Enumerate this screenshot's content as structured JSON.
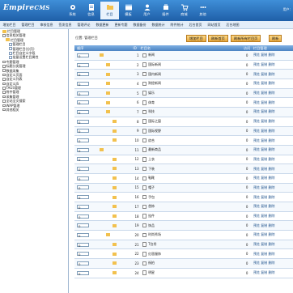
{
  "app": {
    "logo_main": "Empire",
    "logo_sub": "CMS",
    "user_text": "用户:"
  },
  "nav": {
    "items": [
      {
        "label": "系统",
        "icon": "gear-icon"
      },
      {
        "label": "信息",
        "icon": "doc-icon"
      },
      {
        "label": "栏目",
        "icon": "folder-icon",
        "active": true
      },
      {
        "label": "模板",
        "icon": "template-icon"
      },
      {
        "label": "用户",
        "icon": "user-icon"
      },
      {
        "label": "插件",
        "icon": "plugin-icon"
      },
      {
        "label": "商城",
        "icon": "cart-icon"
      },
      {
        "label": "其他",
        "icon": "other-icon"
      }
    ]
  },
  "subnav": {
    "items": [
      "增加栏目",
      "管理栏目",
      "审核信息",
      "签发信息",
      "管理评论",
      "数据更新",
      "更新专题",
      "数据备份",
      "数据统计",
      "附件统计",
      "后台首页",
      "网站首页",
      "后台地图"
    ]
  },
  "sidebar": {
    "items": [
      {
        "label": "栏目管理",
        "level": 0,
        "icon": "folder"
      },
      {
        "label": "信息相关管理",
        "level": 0,
        "icon": "plus"
      },
      {
        "label": "栏目管理",
        "level": 1,
        "icon": "folder"
      },
      {
        "label": "管理栏目",
        "level": 2,
        "icon": "doc"
      },
      {
        "label": "管理栏目(分页)",
        "level": 2,
        "icon": "doc"
      },
      {
        "label": "栏目自定义字段",
        "level": 2,
        "icon": "doc"
      },
      {
        "label": "批量设置栏目属性",
        "level": 2,
        "icon": "doc"
      },
      {
        "label": "专题管理",
        "level": 0,
        "icon": "plus"
      },
      {
        "label": "标题分类管理",
        "level": 0,
        "icon": "plus"
      },
      {
        "label": "数据采集",
        "level": 0,
        "icon": "plus"
      },
      {
        "label": "自定义页面",
        "level": 0,
        "icon": "plus"
      },
      {
        "label": "自定义列表",
        "level": 0,
        "icon": "plus"
      },
      {
        "label": "自定义JS",
        "level": 0,
        "icon": "plus"
      },
      {
        "label": "TAGS管理",
        "level": 0,
        "icon": "plus"
      },
      {
        "label": "附件管理",
        "level": 0,
        "icon": "plus"
      },
      {
        "label": "采集管理",
        "level": 0,
        "icon": "plus"
      },
      {
        "label": "全站全文搜索",
        "level": 0,
        "icon": "plus"
      },
      {
        "label": "WAP管理",
        "level": 0,
        "icon": "plus"
      },
      {
        "label": "其他相关",
        "level": 0,
        "icon": "plus"
      }
    ]
  },
  "main": {
    "breadcrumb": "位置: 管理栏目",
    "buttons": [
      "增加栏目",
      "刷新首页",
      "刷新所有栏目页",
      "刷新"
    ],
    "columns": [
      "顺序",
      "",
      "ID",
      "栏目名",
      "访问",
      "栏目管理"
    ],
    "ops_text": "预览 复制 删除",
    "rows": [
      {
        "order": "0",
        "id": "1",
        "name": "新闻",
        "depth": 0,
        "visit": "0"
      },
      {
        "order": "0",
        "id": "2",
        "name": "国际新闻",
        "depth": 1,
        "visit": "0"
      },
      {
        "order": "0",
        "id": "3",
        "name": "国内新闻",
        "depth": 1,
        "visit": "0"
      },
      {
        "order": "0",
        "id": "4",
        "name": "财经新闻",
        "depth": 1,
        "visit": "0"
      },
      {
        "order": "0",
        "id": "5",
        "name": "娱乐",
        "depth": 1,
        "visit": "0"
      },
      {
        "order": "0",
        "id": "6",
        "name": "体育",
        "depth": 1,
        "visit": "0"
      },
      {
        "order": "0",
        "id": "7",
        "name": "科技",
        "depth": 1,
        "visit": "0"
      },
      {
        "order": "0",
        "id": "8",
        "name": "国际之窗",
        "depth": 2,
        "visit": "0"
      },
      {
        "order": "0",
        "id": "9",
        "name": "国际视野",
        "depth": 2,
        "visit": "0"
      },
      {
        "order": "0",
        "id": "10",
        "name": "综合",
        "depth": 2,
        "visit": "0"
      },
      {
        "order": "0",
        "id": "11",
        "name": "最新商品",
        "depth": 0,
        "visit": "0"
      },
      {
        "order": "0",
        "id": "12",
        "name": "上衣",
        "depth": 2,
        "visit": "0"
      },
      {
        "order": "0",
        "id": "13",
        "name": "下装",
        "depth": 2,
        "visit": "0"
      },
      {
        "order": "0",
        "id": "14",
        "name": "鞋靴",
        "depth": 2,
        "visit": "0"
      },
      {
        "order": "0",
        "id": "15",
        "name": "帽子",
        "depth": 2,
        "visit": "0"
      },
      {
        "order": "0",
        "id": "16",
        "name": "手包",
        "depth": 2,
        "visit": "0"
      },
      {
        "order": "0",
        "id": "17",
        "name": "首饰",
        "depth": 2,
        "visit": "0"
      },
      {
        "order": "0",
        "id": "18",
        "name": "挂件",
        "depth": 2,
        "visit": "0"
      },
      {
        "order": "0",
        "id": "19",
        "name": "饰品",
        "depth": 2,
        "visit": "0"
      },
      {
        "order": "0",
        "id": "20",
        "name": "时尚秀场",
        "depth": 1,
        "visit": "0"
      },
      {
        "order": "0",
        "id": "21",
        "name": "T台秀",
        "depth": 2,
        "visit": "0"
      },
      {
        "order": "0",
        "id": "22",
        "name": "红毯服饰",
        "depth": 2,
        "visit": "0"
      },
      {
        "order": "0",
        "id": "23",
        "name": "街拍",
        "depth": 2,
        "visit": "0"
      },
      {
        "order": "0",
        "id": "24",
        "name": "明星",
        "depth": 2,
        "visit": "0"
      }
    ]
  },
  "colors": {
    "topbar": "#1f5fa8",
    "accent_button": "#e8a83c",
    "grid_header": "#4b83c2",
    "folder": "#f2c14e"
  }
}
